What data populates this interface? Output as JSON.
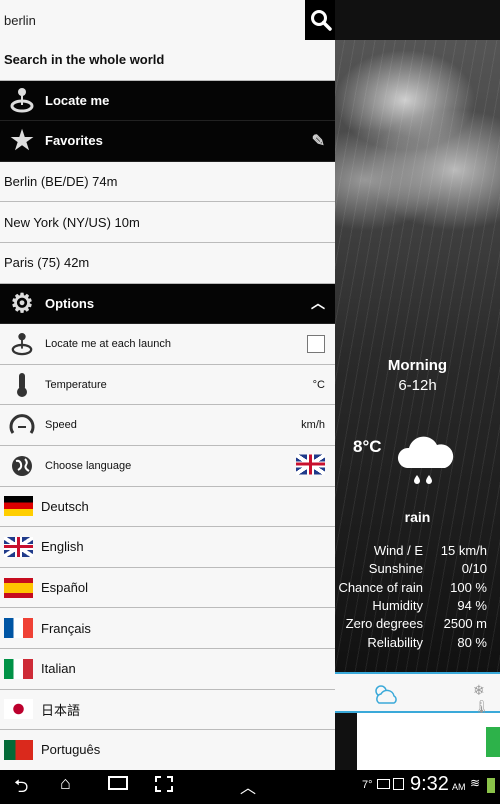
{
  "search": {
    "value": "berlin"
  },
  "menu": {
    "search_world": "Search in the whole world",
    "locate_me": "Locate me",
    "favorites": "Favorites",
    "favorite_items": [
      "Berlin (BE/DE) 74m",
      "New York (NY/US) 10m",
      "Paris (75) 42m"
    ],
    "options": "Options",
    "option_items": [
      {
        "label": "Locate me at each launch",
        "value": "",
        "icon": "location-pin-icon"
      },
      {
        "label": "Temperature",
        "value": "°C",
        "icon": "thermometer-icon"
      },
      {
        "label": "Speed",
        "value": "km/h",
        "icon": "speedometer-icon"
      },
      {
        "label": "Choose language",
        "value": "",
        "icon": "globe-icon"
      }
    ],
    "languages": [
      "Deutsch",
      "English",
      "Español",
      "Français",
      "Italian",
      "日本語",
      "Português"
    ]
  },
  "weather": {
    "period": "Morning",
    "hours": "6-12h",
    "temp": "8°C",
    "condition": "rain",
    "stats": [
      {
        "label": "Wind / E",
        "value": "15 km/h"
      },
      {
        "label": "Sunshine",
        "value": "0/10"
      },
      {
        "label": "Chance of rain",
        "value": "100 %"
      },
      {
        "label": "Humidity",
        "value": "94 %"
      },
      {
        "label": "Zero degrees",
        "value": "2500 m"
      },
      {
        "label": "Reliability",
        "value": "80 %"
      }
    ],
    "accent": "#3aa9d9"
  },
  "statusbar": {
    "temp": "7°",
    "time": "9:32",
    "ampm": "AM"
  }
}
